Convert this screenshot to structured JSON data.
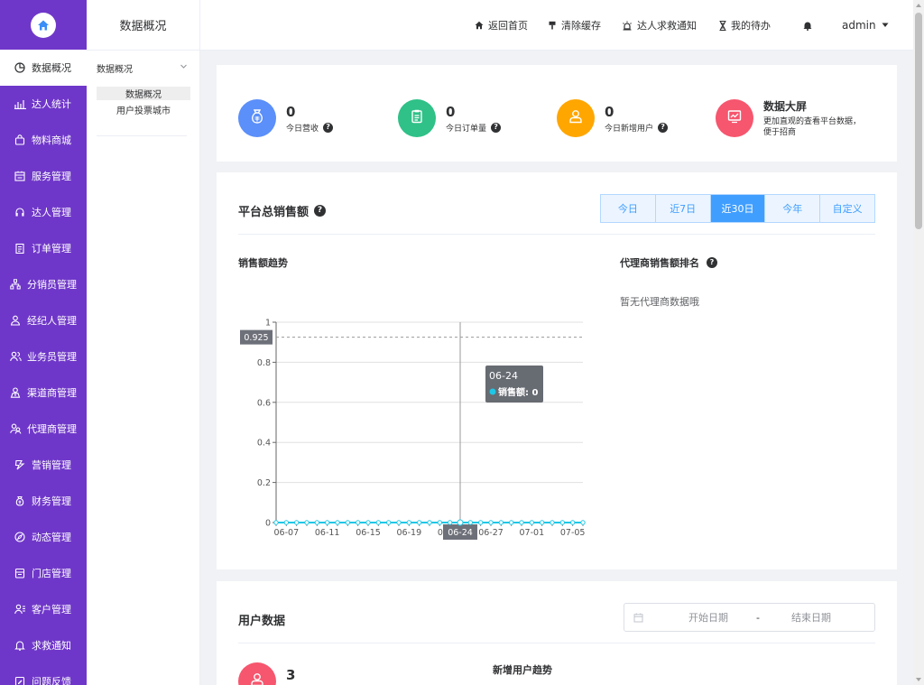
{
  "sidebar": {
    "items": [
      {
        "label": "数据概况",
        "icon": "pie-chart-icon",
        "active": true
      },
      {
        "label": "达人统计",
        "icon": "bar-chart-icon"
      },
      {
        "label": "物料商城",
        "icon": "shopping-bag-icon"
      },
      {
        "label": "服务管理",
        "icon": "service-icon"
      },
      {
        "label": "达人管理",
        "icon": "headset-icon"
      },
      {
        "label": "订单管理",
        "icon": "clipboard-icon"
      },
      {
        "label": "分销员管理",
        "icon": "network-icon"
      },
      {
        "label": "经纪人管理",
        "icon": "user-badge-icon"
      },
      {
        "label": "业务员管理",
        "icon": "users-icon"
      },
      {
        "label": "渠道商管理",
        "icon": "user-tie-icon"
      },
      {
        "label": "代理商管理",
        "icon": "user-group-icon"
      },
      {
        "label": "营销管理",
        "icon": "marketing-icon"
      },
      {
        "label": "财务管理",
        "icon": "money-bag-icon"
      },
      {
        "label": "动态管理",
        "icon": "compass-icon"
      },
      {
        "label": "门店管理",
        "icon": "store-icon"
      },
      {
        "label": "客户管理",
        "icon": "customer-icon"
      },
      {
        "label": "求救通知",
        "icon": "bell-icon"
      },
      {
        "label": "问题反馈",
        "icon": "feedback-icon"
      }
    ]
  },
  "submenu": {
    "title": "数据概况",
    "group_label": "数据概况",
    "links": [
      {
        "label": "数据概况",
        "active": true
      },
      {
        "label": "用户投票城市"
      }
    ]
  },
  "topbar": {
    "items": [
      "返回首页",
      "清除缓存",
      "达人求救通知",
      "我的待办"
    ],
    "user": "admin"
  },
  "stats": [
    {
      "value": "0",
      "label": "今日营收",
      "color": "#5b8ff9",
      "icon": "money-bag-icon"
    },
    {
      "value": "0",
      "label": "今日订单量",
      "color": "#2fc187",
      "icon": "clipboard-icon"
    },
    {
      "value": "0",
      "label": "今日新增用户",
      "color": "#ffa600",
      "icon": "user-icon"
    }
  ],
  "big_screen": {
    "title": "数据大屏",
    "desc": "更加直观的查看平台数据，便于招商",
    "color": "#f6566e",
    "icon": "monitor-chart-icon"
  },
  "sales": {
    "title": "平台总销售额",
    "ranges": [
      "今日",
      "近7日",
      "近30日",
      "今年",
      "自定义"
    ],
    "active_range": "近30日",
    "trend_title": "销售额趋势",
    "ranking_title": "代理商销售额排名",
    "ranking_empty": "暂无代理商数据哦"
  },
  "chart_data": {
    "type": "line",
    "x": [
      "06-06",
      "06-07",
      "06-08",
      "06-09",
      "06-10",
      "06-11",
      "06-12",
      "06-13",
      "06-14",
      "06-15",
      "06-16",
      "06-17",
      "06-18",
      "06-19",
      "06-20",
      "06-21",
      "06-22",
      "06-23",
      "06-24",
      "06-25",
      "06-26",
      "06-27",
      "06-28",
      "06-29",
      "06-30",
      "07-01",
      "07-02",
      "07-03",
      "07-04",
      "07-05",
      "07-06"
    ],
    "x_tick_labels": [
      "06-07",
      "06-11",
      "06-15",
      "06-19",
      "06-23",
      "06-27",
      "07-01",
      "07-05"
    ],
    "series": [
      {
        "name": "销售额",
        "color": "#1fc7e6",
        "values": [
          0,
          0,
          0,
          0,
          0,
          0,
          0,
          0,
          0,
          0,
          0,
          0,
          0,
          0,
          0,
          0,
          0,
          0,
          0,
          0,
          0,
          0,
          0,
          0,
          0,
          0,
          0,
          0,
          0,
          0,
          0
        ]
      }
    ],
    "ylim": [
      0,
      1
    ],
    "y_ticks": [
      "0",
      "0.2",
      "0.4",
      "0.6",
      "0.8",
      "1"
    ],
    "grid": true,
    "crosshair": {
      "x": "06-24",
      "y": 0.925,
      "y_label": "0.925"
    },
    "tooltip": {
      "title": "06-24",
      "series": "销售额",
      "value": "0"
    }
  },
  "user_data": {
    "title": "用户数据",
    "start_placeholder": "开始日期",
    "end_placeholder": "结束日期",
    "separator": "-",
    "total_value": "3",
    "trend_title": "新增用户趋势"
  }
}
